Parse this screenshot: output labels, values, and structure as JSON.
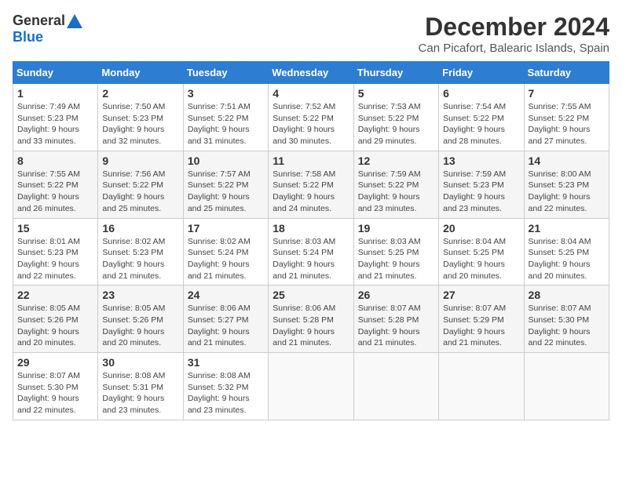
{
  "header": {
    "logo_general": "General",
    "logo_blue": "Blue",
    "title": "December 2024",
    "location": "Can Picafort, Balearic Islands, Spain"
  },
  "weekdays": [
    "Sunday",
    "Monday",
    "Tuesday",
    "Wednesday",
    "Thursday",
    "Friday",
    "Saturday"
  ],
  "weeks": [
    [
      {
        "day": "1",
        "sunrise": "7:49 AM",
        "sunset": "5:23 PM",
        "daylight": "9 hours and 33 minutes."
      },
      {
        "day": "2",
        "sunrise": "7:50 AM",
        "sunset": "5:23 PM",
        "daylight": "9 hours and 32 minutes."
      },
      {
        "day": "3",
        "sunrise": "7:51 AM",
        "sunset": "5:22 PM",
        "daylight": "9 hours and 31 minutes."
      },
      {
        "day": "4",
        "sunrise": "7:52 AM",
        "sunset": "5:22 PM",
        "daylight": "9 hours and 30 minutes."
      },
      {
        "day": "5",
        "sunrise": "7:53 AM",
        "sunset": "5:22 PM",
        "daylight": "9 hours and 29 minutes."
      },
      {
        "day": "6",
        "sunrise": "7:54 AM",
        "sunset": "5:22 PM",
        "daylight": "9 hours and 28 minutes."
      },
      {
        "day": "7",
        "sunrise": "7:55 AM",
        "sunset": "5:22 PM",
        "daylight": "9 hours and 27 minutes."
      }
    ],
    [
      {
        "day": "8",
        "sunrise": "7:55 AM",
        "sunset": "5:22 PM",
        "daylight": "9 hours and 26 minutes."
      },
      {
        "day": "9",
        "sunrise": "7:56 AM",
        "sunset": "5:22 PM",
        "daylight": "9 hours and 25 minutes."
      },
      {
        "day": "10",
        "sunrise": "7:57 AM",
        "sunset": "5:22 PM",
        "daylight": "9 hours and 25 minutes."
      },
      {
        "day": "11",
        "sunrise": "7:58 AM",
        "sunset": "5:22 PM",
        "daylight": "9 hours and 24 minutes."
      },
      {
        "day": "12",
        "sunrise": "7:59 AM",
        "sunset": "5:22 PM",
        "daylight": "9 hours and 23 minutes."
      },
      {
        "day": "13",
        "sunrise": "7:59 AM",
        "sunset": "5:23 PM",
        "daylight": "9 hours and 23 minutes."
      },
      {
        "day": "14",
        "sunrise": "8:00 AM",
        "sunset": "5:23 PM",
        "daylight": "9 hours and 22 minutes."
      }
    ],
    [
      {
        "day": "15",
        "sunrise": "8:01 AM",
        "sunset": "5:23 PM",
        "daylight": "9 hours and 22 minutes."
      },
      {
        "day": "16",
        "sunrise": "8:02 AM",
        "sunset": "5:23 PM",
        "daylight": "9 hours and 21 minutes."
      },
      {
        "day": "17",
        "sunrise": "8:02 AM",
        "sunset": "5:24 PM",
        "daylight": "9 hours and 21 minutes."
      },
      {
        "day": "18",
        "sunrise": "8:03 AM",
        "sunset": "5:24 PM",
        "daylight": "9 hours and 21 minutes."
      },
      {
        "day": "19",
        "sunrise": "8:03 AM",
        "sunset": "5:25 PM",
        "daylight": "9 hours and 21 minutes."
      },
      {
        "day": "20",
        "sunrise": "8:04 AM",
        "sunset": "5:25 PM",
        "daylight": "9 hours and 20 minutes."
      },
      {
        "day": "21",
        "sunrise": "8:04 AM",
        "sunset": "5:25 PM",
        "daylight": "9 hours and 20 minutes."
      }
    ],
    [
      {
        "day": "22",
        "sunrise": "8:05 AM",
        "sunset": "5:26 PM",
        "daylight": "9 hours and 20 minutes."
      },
      {
        "day": "23",
        "sunrise": "8:05 AM",
        "sunset": "5:26 PM",
        "daylight": "9 hours and 20 minutes."
      },
      {
        "day": "24",
        "sunrise": "8:06 AM",
        "sunset": "5:27 PM",
        "daylight": "9 hours and 21 minutes."
      },
      {
        "day": "25",
        "sunrise": "8:06 AM",
        "sunset": "5:28 PM",
        "daylight": "9 hours and 21 minutes."
      },
      {
        "day": "26",
        "sunrise": "8:07 AM",
        "sunset": "5:28 PM",
        "daylight": "9 hours and 21 minutes."
      },
      {
        "day": "27",
        "sunrise": "8:07 AM",
        "sunset": "5:29 PM",
        "daylight": "9 hours and 21 minutes."
      },
      {
        "day": "28",
        "sunrise": "8:07 AM",
        "sunset": "5:30 PM",
        "daylight": "9 hours and 22 minutes."
      }
    ],
    [
      {
        "day": "29",
        "sunrise": "8:07 AM",
        "sunset": "5:30 PM",
        "daylight": "9 hours and 22 minutes."
      },
      {
        "day": "30",
        "sunrise": "8:08 AM",
        "sunset": "5:31 PM",
        "daylight": "9 hours and 23 minutes."
      },
      {
        "day": "31",
        "sunrise": "8:08 AM",
        "sunset": "5:32 PM",
        "daylight": "9 hours and 23 minutes."
      },
      null,
      null,
      null,
      null
    ]
  ]
}
